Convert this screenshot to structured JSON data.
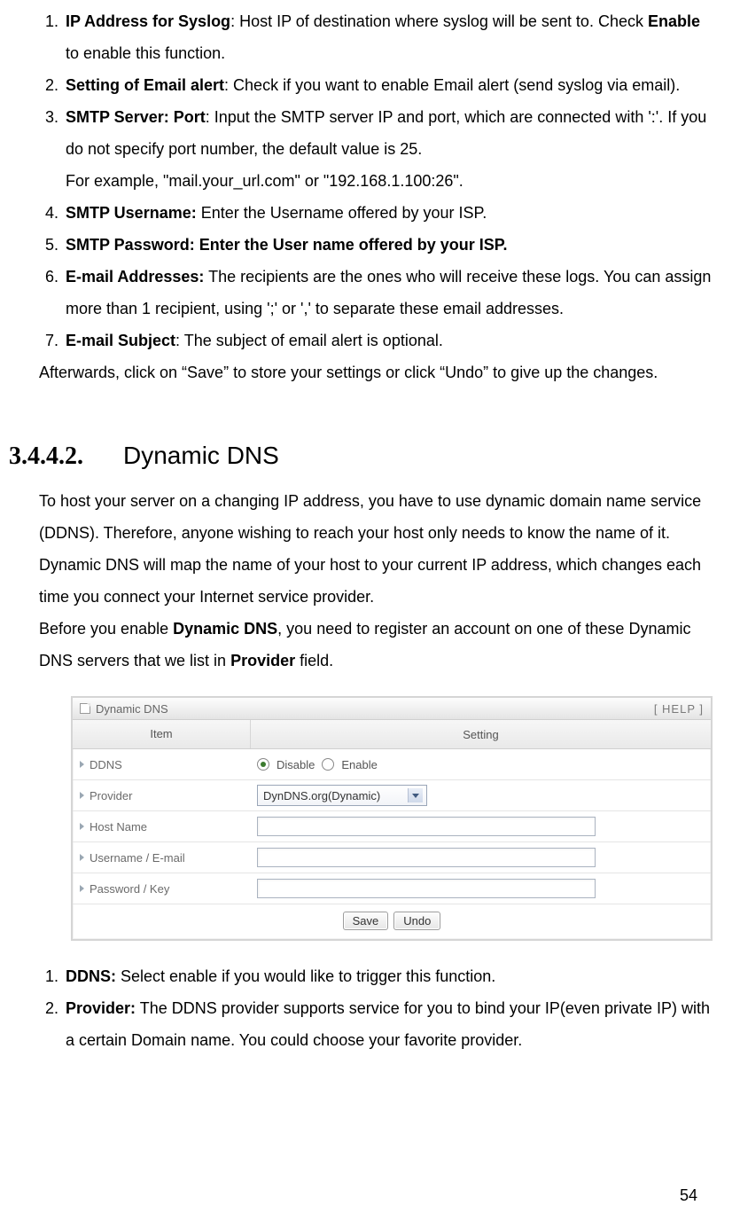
{
  "listA": [
    {
      "n": "1.",
      "label": "IP Address for Syslog",
      "rest": ": Host IP of destination where syslog will be sent to. Check ",
      "label2": "Enable",
      "rest2": " to enable this function."
    },
    {
      "n": "2.",
      "label": "Setting of Email alert",
      "rest": ": Check if you want to enable Email alert (send syslog via email)."
    },
    {
      "n": "3.",
      "label": "SMTP Server: Port",
      "rest": ": Input the SMTP server IP and port, which are connected with ':'. If you do not specify port number, the default value is 25.",
      "extra": "For example, \"mail.your_url.com\" or \"192.168.1.100:26\"."
    },
    {
      "n": "4.",
      "label": "SMTP Username:",
      "rest": " Enter the Username offered by your ISP."
    },
    {
      "n": "5.",
      "label": "SMTP Password: Enter the User name offered by your ISP."
    },
    {
      "n": "6.",
      "label": "E-mail Addresses:",
      "rest": " The recipients are the ones who will receive these logs. You can assign more than 1 recipient, using ';' or ',' to separate these email addresses."
    },
    {
      "n": "7.",
      "label": "E-mail Subject",
      "rest": ": The subject of email alert is optional."
    }
  ],
  "afterA": "Afterwards, click on “Save” to store your settings or click “Undo” to give up the changes.",
  "heading": {
    "num": "3.4.4.2.",
    "title": "Dynamic DNS"
  },
  "para1": "To host your server on a changing IP address, you have to use dynamic domain name service (DDNS). Therefore, anyone wishing to reach your host only needs to know the name of it. Dynamic DNS will map the name of your host to your current IP address, which changes each time you connect your Internet service provider.",
  "para2_a": "Before you enable ",
  "para2_b": "Dynamic DNS",
  "para2_c": ", you need to register an account on one of these Dynamic DNS servers that we list in ",
  "para2_d": "Provider",
  "para2_e": " field.",
  "shot": {
    "title": "Dynamic DNS",
    "help": "[ HELP ]",
    "head_item": "Item",
    "head_setting": "Setting",
    "rows": {
      "ddns": "DDNS",
      "provider": "Provider",
      "host": "Host Name",
      "user": "Username / E-mail",
      "pass": "Password / Key"
    },
    "radio_disable": "Disable",
    "radio_enable": "Enable",
    "provider_value": "DynDNS.org(Dynamic)",
    "btn_save": "Save",
    "btn_undo": "Undo"
  },
  "listB": [
    {
      "n": "1.",
      "label": "DDNS:",
      "rest": " Select enable if you would like to trigger this function."
    },
    {
      "n": "2.",
      "label": "Provider:",
      "rest": " The DDNS provider supports service for you to bind your IP(even private IP) with a certain Domain name. You could choose your favorite provider."
    }
  ],
  "pageNumber": "54"
}
